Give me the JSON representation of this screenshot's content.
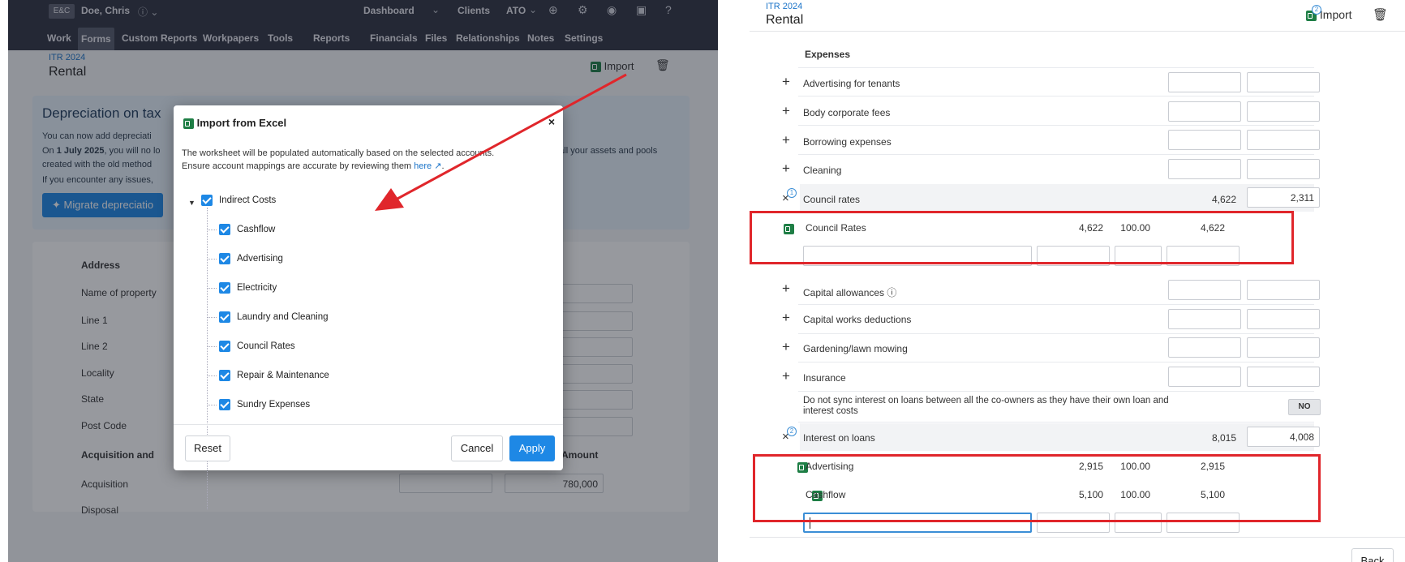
{
  "left": {
    "topbar": {
      "badge": "E&C",
      "user": "Doe, Chris",
      "top_nav": [
        "Dashboard",
        "Clients",
        "ATO"
      ],
      "nav": [
        "Work",
        "Forms",
        "Custom Reports",
        "Workpapers",
        "Tools",
        "Reports",
        "Financials",
        "Files",
        "Relationships",
        "Notes",
        "Settings"
      ]
    },
    "breadcrumb": "ITR 2024",
    "title": "Rental",
    "import_label": "Import",
    "banner": {
      "heading": "Depreciation on tax",
      "line1": "You can now add depreciati",
      "line2_bold": "1 July 2025",
      "line2_a": "On ",
      "line2_b": ", you will no lo",
      "line2_right": "e all your assets and pools",
      "line3": "created with the old method",
      "line4": "If you encounter any issues,",
      "button": "Migrate depreciatio"
    },
    "form": {
      "section": "Address",
      "fields": [
        "Name of property",
        "Line 1",
        "Line 2",
        "Locality",
        "State",
        "Post Code"
      ],
      "section2": "Acquisition and",
      "amount_header": "Amount",
      "rows": [
        {
          "label": "Acquisition",
          "amount": "780,000"
        },
        {
          "label": "Disposal",
          "amount": ""
        }
      ],
      "back": "Back"
    },
    "modal": {
      "title": "Import from Excel",
      "desc_a": "The worksheet will be populated automatically based on the selected accounts.",
      "desc_b": "Ensure account mappings are accurate by reviewing them ",
      "desc_link": "here",
      "root": "Indirect Costs",
      "items": [
        "Cashflow",
        "Advertising",
        "Electricity",
        "Laundry and Cleaning",
        "Council Rates",
        "Repair & Maintenance",
        "Sundry Expenses"
      ],
      "reset": "Reset",
      "cancel": "Cancel",
      "apply": "Apply"
    }
  },
  "right": {
    "breadcrumb": "ITR 2024",
    "title": "Rental",
    "import_label": "Import",
    "import_badge": "2",
    "section": "Expenses",
    "rows_a": [
      "Advertising for tenants",
      "Body corporate fees",
      "Borrowing expenses",
      "Cleaning"
    ],
    "council": {
      "label": "Council rates",
      "total": "4,622",
      "share": "2,311",
      "badge": "1"
    },
    "council_import": {
      "label": "Council Rates",
      "amount": "4,622",
      "pct": "100.00",
      "value": "4,622"
    },
    "rows_b": [
      "Capital allowances",
      "Capital works deductions",
      "Gardening/lawn mowing",
      "Insurance"
    ],
    "sync_text": "Do not sync interest on loans between all the co-owners as they have their own loan and interest costs",
    "sync_toggle": "NO",
    "interest": {
      "label": "Interest on loans",
      "total": "8,015",
      "share": "4,008",
      "badge": "2"
    },
    "interest_imports": [
      {
        "label": "Advertising",
        "amount": "2,915",
        "pct": "100.00",
        "value": "2,915"
      },
      {
        "label": "Cashflow",
        "amount": "5,100",
        "pct": "100.00",
        "value": "5,100"
      }
    ],
    "back": "Back"
  },
  "colors": {
    "accent": "#1e88e5",
    "annotation_red": "#e0262b",
    "excel_green": "#1e7e45",
    "topbar": "#2f3241"
  }
}
